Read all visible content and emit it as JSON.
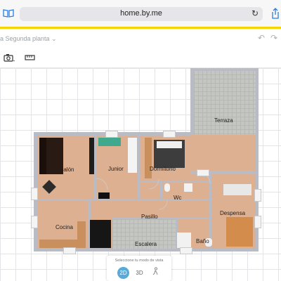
{
  "browser": {
    "url": "home.by.me"
  },
  "toolbar": {
    "floor_label": "a Segunda planta ⌄"
  },
  "rooms": {
    "terraza": "Terraza",
    "salon": "Salón",
    "junior": "Junior",
    "dormitorio": "Dormitorio",
    "wc": "Wc",
    "despensa": "Despensa",
    "cocina": "Cocina",
    "pasillo": "Pasillo",
    "escalera": "Escalera",
    "bano": "Baño"
  },
  "view_panel": {
    "title": "Seleccione tu modo de vista",
    "mode_2d": "2D",
    "mode_3d": "3D",
    "selected": "2D"
  },
  "colors": {
    "accent": "#5aa9d6",
    "brand_bar": "#f5d400",
    "floor": "#deb092",
    "wall": "#b9bcc4"
  },
  "icons": [
    "book-icon",
    "reload-icon",
    "share-icon",
    "undo-icon",
    "redo-icon",
    "camera-icon",
    "ruler-icon",
    "person-view-icon"
  ]
}
